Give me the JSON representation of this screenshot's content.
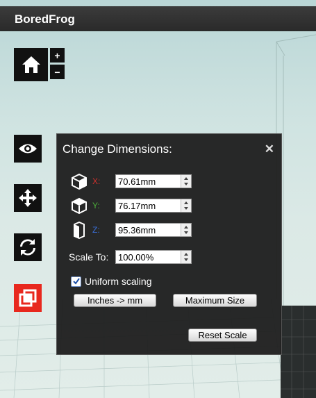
{
  "app": {
    "title": "BoredFrog"
  },
  "toolbar": {
    "zoom_in": "+",
    "zoom_out": "−",
    "tools": [
      "home-icon",
      "eye-icon",
      "move-icon",
      "rotate-icon",
      "scale-icon"
    ],
    "active_tool_color": "#e8281e"
  },
  "panel": {
    "title": "Change Dimensions:",
    "close": "✕",
    "dimensions": [
      {
        "axis": "X:",
        "value": "70.61mm",
        "color": "#d0312d"
      },
      {
        "axis": "Y:",
        "value": "76.17mm",
        "color": "#4caf3a"
      },
      {
        "axis": "Z:",
        "value": "95.36mm",
        "color": "#3a6fd8"
      }
    ],
    "scale_label": "Scale To:",
    "scale_value": "100.00%",
    "uniform_label": "Uniform scaling",
    "uniform_checked": true,
    "inches_button": "Inches -> mm",
    "max_button": "Maximum Size",
    "reset_button": "Reset Scale"
  }
}
